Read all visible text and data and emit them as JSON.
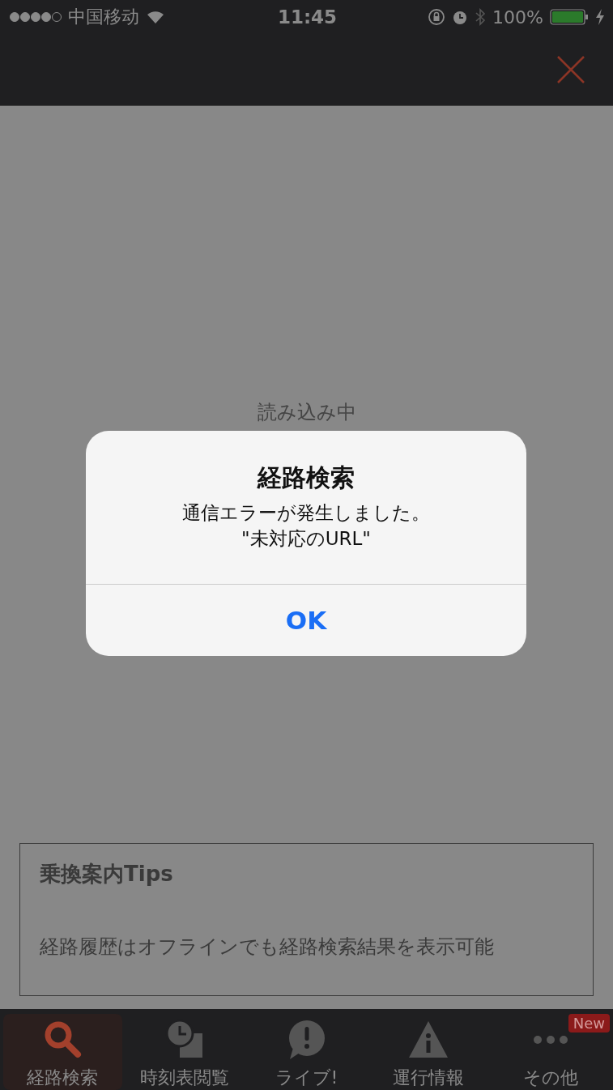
{
  "status_bar": {
    "carrier": "中国移动",
    "time": "11:45",
    "battery": "100%"
  },
  "content": {
    "loading_text": "読み込み中"
  },
  "tips": {
    "title": "乗換案内Tips",
    "body": "経路履歴はオフラインでも経路検索結果を表示可能"
  },
  "dialog": {
    "title": "経路検索",
    "message": [
      "通信エラーが発生しました。",
      "\"未対応のURL\""
    ],
    "buttons": [
      "OK"
    ]
  },
  "tabs": [
    {
      "label": "経路検索",
      "selected": true,
      "kind": "search"
    },
    {
      "label": "時刻表閲覧",
      "selected": false,
      "kind": "timetable"
    },
    {
      "label": "ライブ!",
      "selected": false,
      "kind": "live"
    },
    {
      "label": "運行情報",
      "selected": false,
      "kind": "info"
    },
    {
      "label": "その他",
      "selected": false,
      "kind": "other",
      "badge": "New"
    }
  ]
}
